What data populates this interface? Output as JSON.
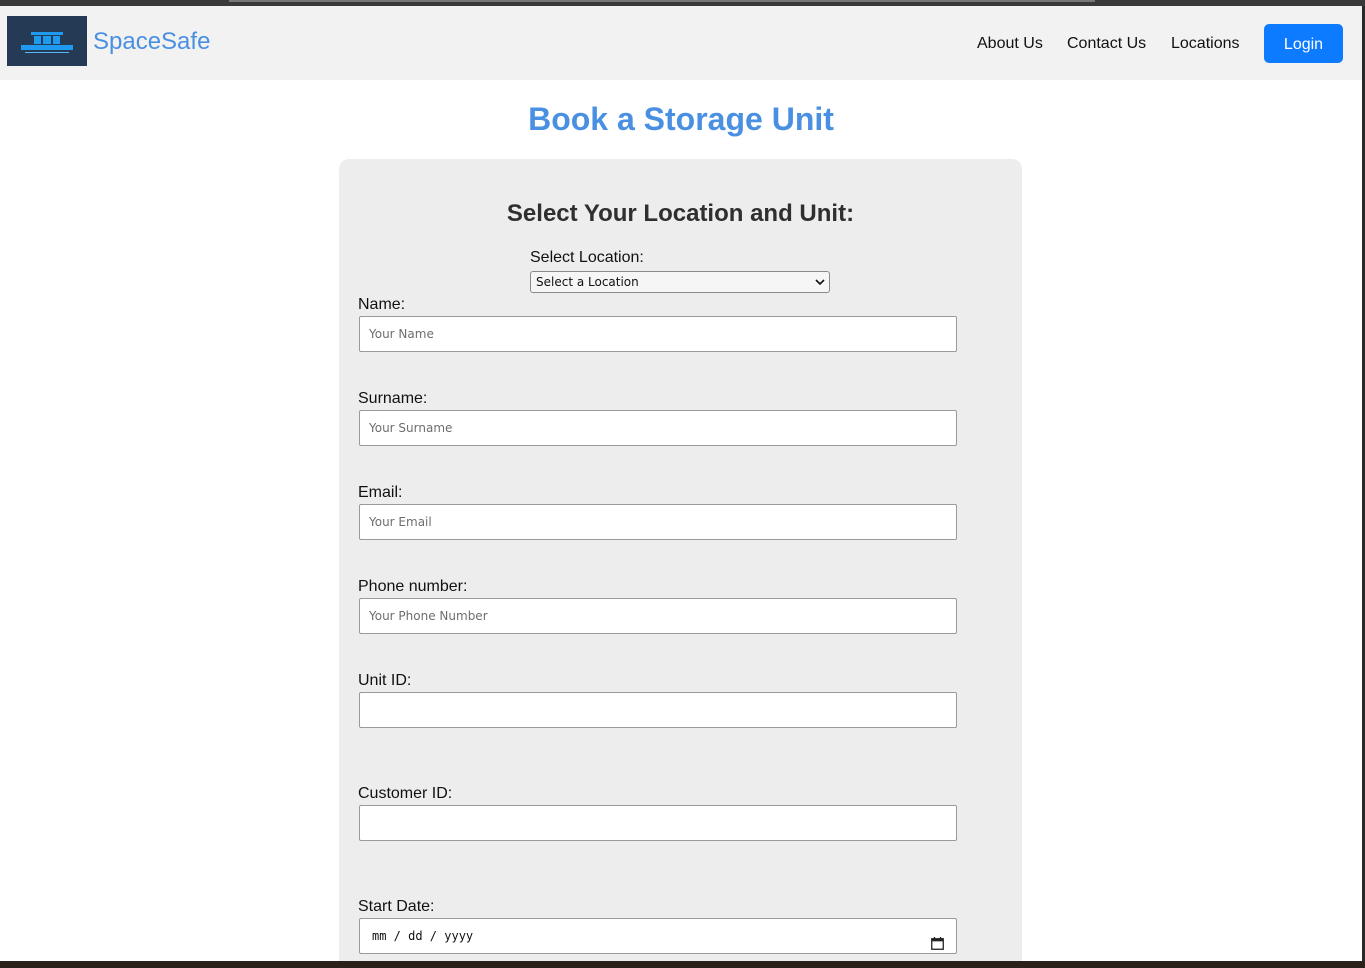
{
  "brand": {
    "name": "SpaceSafe",
    "logo_icon": "storage-building-logo"
  },
  "nav": {
    "links": [
      "About Us",
      "Contact Us",
      "Locations"
    ],
    "login_label": "Login"
  },
  "page": {
    "title": "Book a Storage Unit"
  },
  "form": {
    "section_title": "Select Your Location and Unit:",
    "location": {
      "label": "Select Location:",
      "selected": "Select a Location"
    },
    "fields": {
      "name": {
        "label": "Name:",
        "placeholder": "Your Name"
      },
      "surname": {
        "label": "Surname:",
        "placeholder": "Your Surname"
      },
      "email": {
        "label": "Email:",
        "placeholder": "Your Email"
      },
      "phone": {
        "label": "Phone number:",
        "placeholder": "Your Phone Number"
      },
      "unit_id": {
        "label": "Unit ID:",
        "value": ""
      },
      "customer_id": {
        "label": "Customer ID:",
        "value": ""
      },
      "start_date": {
        "label": "Start Date:",
        "value": "mm / dd / yyyy"
      }
    }
  },
  "colors": {
    "accent": "#4a90e2",
    "login_button": "#0d7bff",
    "navbar": "#f2f2f2",
    "card": "#ededed"
  }
}
